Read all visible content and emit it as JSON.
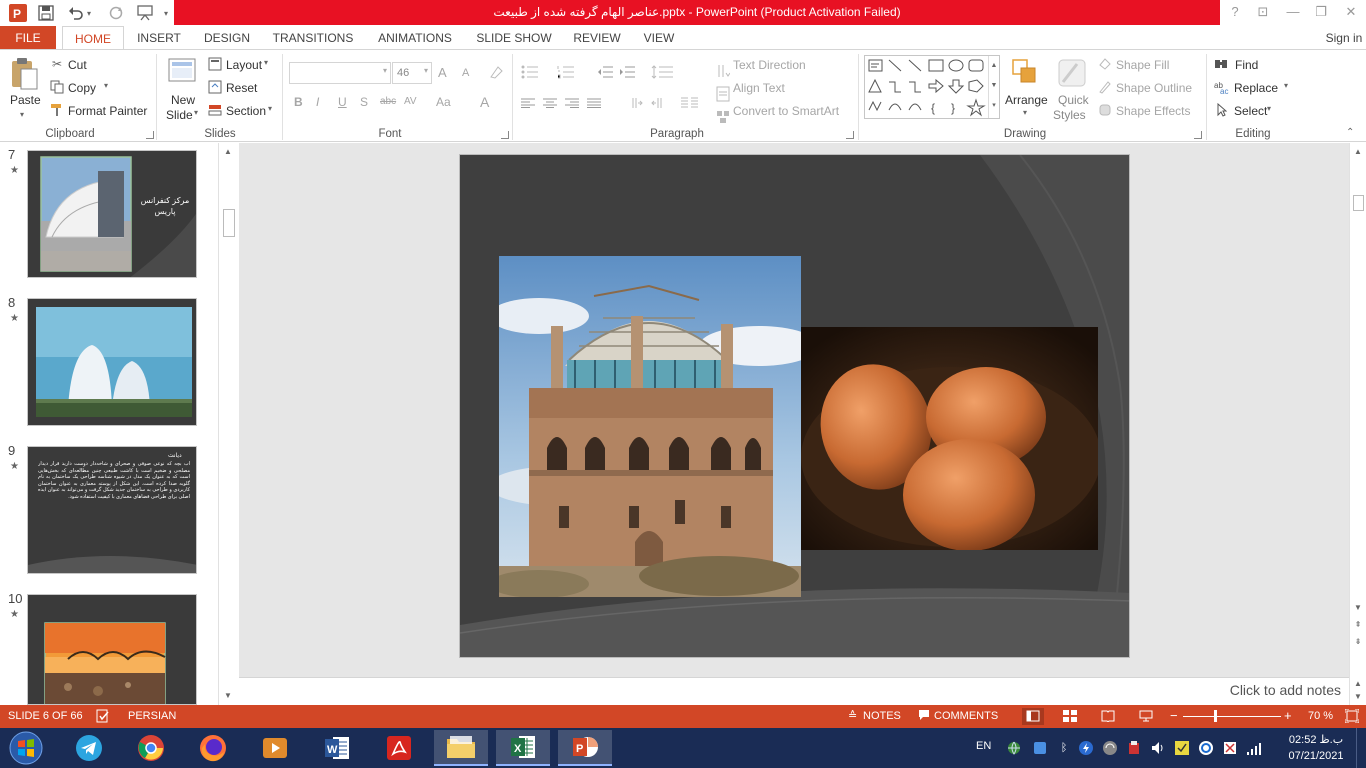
{
  "titlebar": {
    "title": "عناصر الهام گرفته شده از طبیعت.pptx - PowerPoint (Product Activation Failed)",
    "help": "?",
    "ribbon_options": "⊡",
    "minimize": "—",
    "restore": "❐",
    "close": "✕"
  },
  "tabs": [
    {
      "label": "FILE"
    },
    {
      "label": "HOME"
    },
    {
      "label": "INSERT"
    },
    {
      "label": "DESIGN"
    },
    {
      "label": "TRANSITIONS"
    },
    {
      "label": "ANIMATIONS"
    },
    {
      "label": "SLIDE SHOW"
    },
    {
      "label": "REVIEW"
    },
    {
      "label": "VIEW"
    }
  ],
  "signin": "Sign in",
  "ribbon": {
    "clipboard": {
      "paste": "Paste",
      "cut": "Cut",
      "copy": "Copy",
      "format_painter": "Format Painter",
      "label": "Clipboard"
    },
    "slides": {
      "new_slide_1": "New",
      "new_slide_2": "Slide",
      "layout": "Layout",
      "reset": "Reset",
      "section": "Section",
      "label": "Slides"
    },
    "font": {
      "size": "46",
      "label": "Font",
      "bold": "B",
      "italic": "I",
      "underline": "U",
      "shadow": "S",
      "strike": "abc",
      "spacing": "AV",
      "case": "Aa",
      "color": "A",
      "grow": "A",
      "shrink": "A"
    },
    "paragraph": {
      "text_direction": "Text Direction",
      "align_text": "Align Text",
      "convert_smartart": "Convert to SmartArt",
      "label": "Paragraph"
    },
    "drawing": {
      "arrange": "Arrange",
      "quick_styles_1": "Quick",
      "quick_styles_2": "Styles",
      "shape_fill": "Shape Fill",
      "shape_outline": "Shape Outline",
      "shape_effects": "Shape Effects",
      "label": "Drawing"
    },
    "editing": {
      "find": "Find",
      "replace": "Replace",
      "select": "Select",
      "label": "Editing"
    }
  },
  "thumbnails": [
    {
      "num": "7",
      "caption": "مرکز کنفرانس پاریس"
    },
    {
      "num": "8"
    },
    {
      "num": "9",
      "heading": "دیانت",
      "body": "آب بچه که نوعی صوفی و صحرای و شاخه‌دار دوست دارید قرار دیدار مصلحی و ضخیم است با کاشت طبیعی چنین مطالعه‌ای که بخش‌هایی است که به عنوان یک مدل در شیوه شناسه طراحی یک ساختمان به نام گلوبه صدا کرده است. این شکل از پوسته معماری به عنوان ساختمان کاربردی و طراحی به ساختمان جدید شکل گرفت و می‌تواند به عنوان ایده اصلی برای طراحی فضاهای معماری با کیفیت استفاده شود."
    },
    {
      "num": "10"
    }
  ],
  "notes_placeholder": "Click to add notes",
  "status": {
    "slide": "SLIDE 6 OF 66",
    "language": "PERSIAN",
    "notes": "NOTES",
    "comments": "COMMENTS",
    "zoom": "70 %"
  },
  "taskbar": {
    "lang": "EN",
    "time": "02:52 ب.ظ",
    "date": "07/21/2021"
  },
  "colors": {
    "accent": "#d24726",
    "title_bar_error": "#e81123",
    "taskbar": "#1a2c55",
    "slide_bg": "#3f3f3f"
  }
}
